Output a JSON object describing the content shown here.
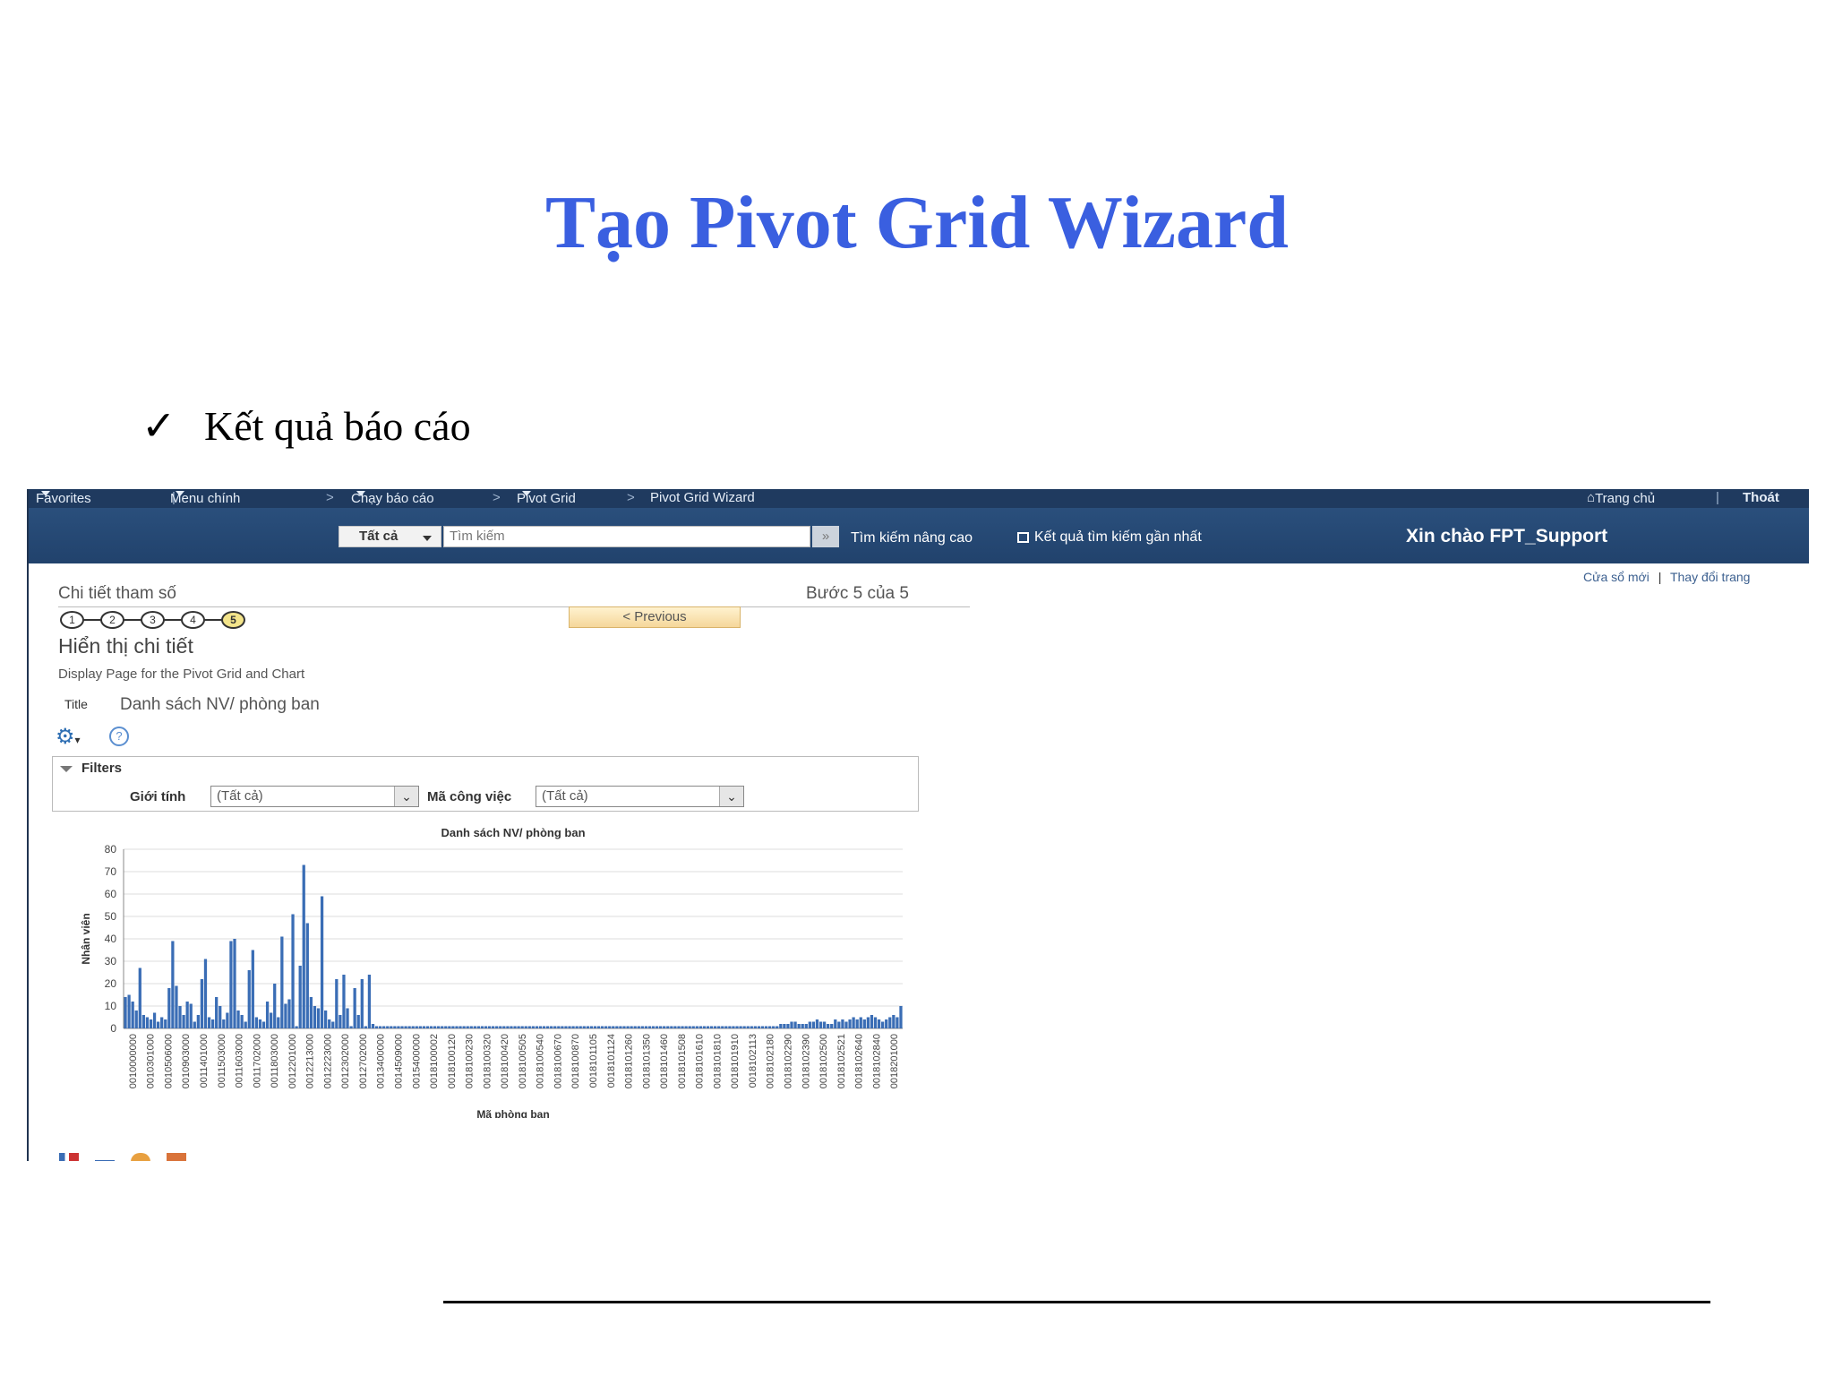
{
  "slide": {
    "title": "Tạo Pivot Grid Wizard",
    "bullet_mark": "✓",
    "bullet": "Kết quả báo cáo"
  },
  "nav": {
    "favorites": "Favorites",
    "main_menu": "Menu chính",
    "breadcrumb_sep": ">",
    "crumbs": [
      "Chạy báo cáo",
      "Pivot Grid",
      "Pivot Grid Wizard"
    ],
    "home": "Trang chủ",
    "logout": "Thoát"
  },
  "search": {
    "scope": "Tất cả",
    "placeholder": "Tìm kiếm",
    "go": "»",
    "advanced": "Tìm kiếm nâng cao",
    "recent": "Kết quả tìm kiếm gần nhất",
    "greeting": "Xin chào FPT_Support"
  },
  "links": {
    "new_window": "Cửa sổ mới",
    "personalize": "Thay đổi trang",
    "sep": "|"
  },
  "wizard": {
    "section": "Chi tiết tham số",
    "step_text": "Bước  5 của  5",
    "previous": "< Previous",
    "steps": [
      "1",
      "2",
      "3",
      "4",
      "5"
    ],
    "current_step": 5,
    "heading": "Hiển thị chi tiết",
    "description": "Display Page for the Pivot Grid and Chart",
    "title_label": "Title",
    "title_value": "Danh sách NV/ phòng ban"
  },
  "filters": {
    "label": "Filters",
    "gender_label": "Giới tính",
    "gender_value": "(Tất cả)",
    "job_label": "Mã công việc",
    "job_value": "(Tất cả)"
  },
  "colors": {
    "accent": "#3a5fe0",
    "navbar": "#1f3a5f",
    "bar": "#3a6db5"
  },
  "chart_data": {
    "type": "bar",
    "title": "Danh sách NV/ phòng ban",
    "xlabel": "Mã phòng ban",
    "ylabel": "Nhân viên",
    "ylim": [
      0,
      80
    ],
    "yticks": [
      0,
      10,
      20,
      30,
      40,
      50,
      60,
      70,
      80
    ],
    "x_tick_labels": [
      "0010000000",
      "0010301000",
      "0010506000",
      "0010903000",
      "0011401000",
      "0011503000",
      "0011603000",
      "0011702000",
      "0011803000",
      "0012201000",
      "0012213000",
      "0012223000",
      "0012302000",
      "0012702000",
      "0013400000",
      "0014509000",
      "0015400000",
      "0018100002",
      "0018100120",
      "0018100230",
      "0018100320",
      "0018100420",
      "0018100505",
      "0018100540",
      "0018100670",
      "0018100870",
      "0018101105",
      "0018101124",
      "0018101260",
      "0018101350",
      "0018101460",
      "0018101508",
      "0018101610",
      "0018101810",
      "0018101910",
      "0018102113",
      "0018102180",
      "0018102290",
      "0018102390",
      "0018102500",
      "0018102521",
      "0018102640",
      "0018102840",
      "0018201000"
    ],
    "values": [
      14,
      15,
      12,
      8,
      27,
      6,
      5,
      4,
      7,
      3,
      5,
      4,
      18,
      39,
      19,
      10,
      6,
      12,
      11,
      3,
      6,
      22,
      31,
      5,
      4,
      14,
      10,
      4,
      7,
      39,
      40,
      8,
      6,
      3,
      26,
      35,
      5,
      4,
      3,
      12,
      7,
      20,
      5,
      41,
      11,
      13,
      51,
      1,
      28,
      73,
      47,
      14,
      10,
      9,
      59,
      8,
      4,
      3,
      22,
      6,
      24,
      9,
      1,
      18,
      6,
      22,
      1,
      24,
      2,
      1,
      1,
      1,
      1,
      1,
      1,
      1,
      1,
      1,
      1,
      1,
      1,
      1,
      1,
      1,
      1,
      1,
      1,
      1,
      1,
      1,
      1,
      1,
      1,
      1,
      1,
      1,
      1,
      1,
      1,
      1,
      1,
      1,
      1,
      1,
      1,
      1,
      1,
      1,
      1,
      1,
      1,
      1,
      1,
      1,
      1,
      1,
      1,
      1,
      1,
      1,
      1,
      1,
      1,
      1,
      1,
      1,
      1,
      1,
      1,
      1,
      1,
      1,
      1,
      1,
      1,
      1,
      1,
      1,
      1,
      1,
      1,
      1,
      1,
      1,
      1,
      1,
      1,
      1,
      1,
      1,
      1,
      1,
      1,
      1,
      1,
      1,
      1,
      1,
      1,
      1,
      1,
      1,
      1,
      1,
      1,
      1,
      1,
      1,
      1,
      1,
      1,
      1,
      1,
      1,
      1,
      1,
      1,
      1,
      1,
      1,
      2,
      2,
      2,
      3,
      3,
      2,
      2,
      2,
      3,
      3,
      4,
      3,
      3,
      2,
      2,
      4,
      3,
      4,
      3,
      4,
      5,
      4,
      5,
      4,
      5,
      6,
      5,
      4,
      3,
      4,
      5,
      6,
      5,
      10
    ],
    "grid": true
  }
}
